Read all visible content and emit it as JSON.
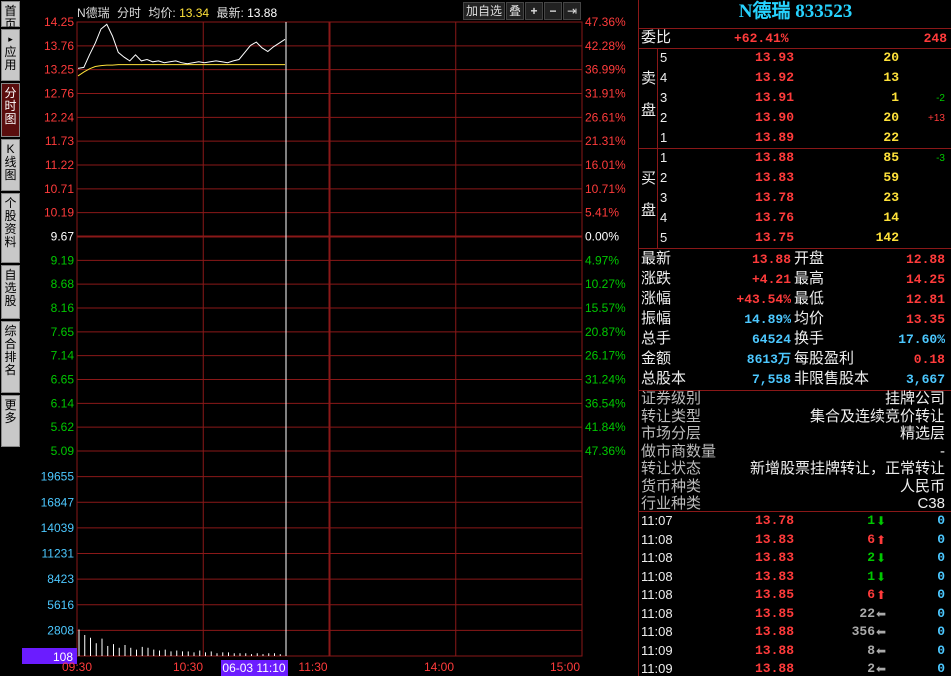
{
  "left_tabs": [
    {
      "label": "首页"
    },
    {
      "label": "应用",
      "prefix": "▸"
    },
    {
      "label": "分时图",
      "active": true
    },
    {
      "label": "K线图"
    },
    {
      "label": "个股资料"
    },
    {
      "label": "自选股"
    },
    {
      "label": "综合排名"
    },
    {
      "label": "更多"
    }
  ],
  "chart": {
    "header": {
      "name": "N德瑞",
      "mode": "分时",
      "avg_label": "均价:",
      "avg_value": "13.34",
      "last_label": "最新:",
      "last_value": "13.88"
    },
    "toolbar": {
      "add_fav": "加自选",
      "overlay": "叠"
    },
    "price_ticks": [
      "14.25",
      "13.76",
      "13.25",
      "12.76",
      "12.24",
      "11.73",
      "11.22",
      "10.71",
      "10.19",
      "9.67",
      "9.19",
      "8.68",
      "8.16",
      "7.65",
      "7.14",
      "6.65",
      "6.14",
      "5.62",
      "5.09"
    ],
    "pct_ticks": [
      "47.36%",
      "42.28%",
      "36.99%",
      "31.91%",
      "26.61%",
      "21.31%",
      "16.01%",
      "10.71%",
      "5.41%",
      "0.00%",
      "4.97%",
      "10.27%",
      "15.57%",
      "20.87%",
      "26.17%",
      "31.24%",
      "36.54%",
      "41.84%",
      "47.36%"
    ],
    "volume_ticks": [
      "19655",
      "16847",
      "14039",
      "11231",
      "8423",
      "5616",
      "2808"
    ],
    "cursor_volume": "108",
    "time_ticks": [
      "09:30",
      "10:30",
      "11:30",
      "14:00",
      "15:00"
    ],
    "cursor_time": "06-03 11:10",
    "price_line": [
      13.26,
      13.28,
      13.55,
      13.8,
      14.1,
      14.2,
      13.95,
      13.6,
      13.5,
      13.42,
      13.55,
      13.42,
      13.45,
      13.4,
      13.42,
      13.38,
      13.4,
      13.42,
      13.38,
      13.36,
      13.38,
      13.4,
      13.38,
      13.4,
      13.42,
      13.4,
      13.38,
      13.42,
      13.45,
      13.6,
      13.75,
      13.82,
      13.7,
      13.62,
      13.72,
      13.8,
      13.88
    ],
    "avg_line": [
      13.1,
      13.18,
      13.25,
      13.3,
      13.32,
      13.33,
      13.33,
      13.34,
      13.34,
      13.34,
      13.34,
      13.34,
      13.34,
      13.34,
      13.34,
      13.34,
      13.34,
      13.34,
      13.34,
      13.34,
      13.34,
      13.34,
      13.34,
      13.34,
      13.34,
      13.34,
      13.34,
      13.34,
      13.34,
      13.34,
      13.34,
      13.34,
      13.34,
      13.34,
      13.34,
      13.34,
      13.34
    ],
    "volumes": [
      2900,
      2300,
      2000,
      1400,
      1900,
      1100,
      1300,
      900,
      1200,
      900,
      700,
      1000,
      900,
      700,
      600,
      700,
      500,
      600,
      500,
      500,
      400,
      600,
      400,
      500,
      300,
      400,
      400,
      300,
      300,
      300,
      200,
      300,
      200,
      300,
      300,
      200,
      400
    ]
  },
  "quote": {
    "title": "N德瑞 833523",
    "ratio": {
      "label": "委比",
      "pct": "+62.41%",
      "diff": "248"
    },
    "sell_label": [
      "卖",
      "盘"
    ],
    "buy_label": [
      "买",
      "盘"
    ],
    "asks": [
      {
        "lv": "5",
        "p": "13.93",
        "v": "20",
        "c": ""
      },
      {
        "lv": "4",
        "p": "13.92",
        "v": "13",
        "c": ""
      },
      {
        "lv": "3",
        "p": "13.91",
        "v": "1",
        "c": "-2"
      },
      {
        "lv": "2",
        "p": "13.90",
        "v": "20",
        "c": "+13"
      },
      {
        "lv": "1",
        "p": "13.89",
        "v": "22",
        "c": ""
      }
    ],
    "bids": [
      {
        "lv": "1",
        "p": "13.88",
        "v": "85",
        "c": "-3"
      },
      {
        "lv": "2",
        "p": "13.83",
        "v": "59",
        "c": ""
      },
      {
        "lv": "3",
        "p": "13.78",
        "v": "23",
        "c": ""
      },
      {
        "lv": "4",
        "p": "13.76",
        "v": "14",
        "c": ""
      },
      {
        "lv": "5",
        "p": "13.75",
        "v": "142",
        "c": ""
      }
    ],
    "stats": [
      {
        "l1": "最新",
        "v1": "13.88",
        "c1": "red",
        "l2": "开盘",
        "v2": "12.88",
        "c2": "red"
      },
      {
        "l1": "涨跌",
        "v1": "+4.21",
        "c1": "red",
        "l2": "最高",
        "v2": "14.25",
        "c2": "red"
      },
      {
        "l1": "涨幅",
        "v1": "+43.54%",
        "c1": "red",
        "l2": "最低",
        "v2": "12.81",
        "c2": "red"
      },
      {
        "l1": "振幅",
        "v1": "14.89%",
        "c1": "cyan",
        "l2": "均价",
        "v2": "13.35",
        "c2": "red"
      },
      {
        "l1": "总手",
        "v1": "64524",
        "c1": "cyan",
        "l2": "换手",
        "v2": "17.60%",
        "c2": "cyan"
      },
      {
        "l1": "金额",
        "v1": "8613万",
        "c1": "cyan",
        "l2": "每股盈利",
        "v2": "0.18",
        "c2": "red"
      },
      {
        "l1": "总股本",
        "v1": "7,558",
        "c1": "cyan",
        "l2": "非限售股本",
        "v2": "3,667",
        "c2": "cyan"
      }
    ],
    "info": [
      {
        "k": "证券级别",
        "v": "挂牌公司"
      },
      {
        "k": "转让类型",
        "v": "集合及连续竞价转让"
      },
      {
        "k": "市场分层",
        "v": "精选层"
      },
      {
        "k": "做市商数量",
        "v": "-"
      },
      {
        "k": "转让状态",
        "v": "新增股票挂牌转让，正常转让"
      },
      {
        "k": "货币种类",
        "v": "人民币"
      },
      {
        "k": "行业种类",
        "v": "C38"
      }
    ],
    "trades": [
      {
        "t": "11:07",
        "p": "13.78",
        "v": "1",
        "dir": "down",
        "n": "0"
      },
      {
        "t": "11:08",
        "p": "13.83",
        "v": "6",
        "dir": "up",
        "n": "0"
      },
      {
        "t": "11:08",
        "p": "13.83",
        "v": "2",
        "dir": "down",
        "n": "0"
      },
      {
        "t": "11:08",
        "p": "13.83",
        "v": "1",
        "dir": "down",
        "n": "0"
      },
      {
        "t": "11:08",
        "p": "13.85",
        "v": "6",
        "dir": "up",
        "n": "0"
      },
      {
        "t": "11:08",
        "p": "13.85",
        "v": "22",
        "dir": "left",
        "n": "0"
      },
      {
        "t": "11:08",
        "p": "13.88",
        "v": "356",
        "dir": "left",
        "n": "0"
      },
      {
        "t": "11:09",
        "p": "13.88",
        "v": "8",
        "dir": "left",
        "n": "0"
      },
      {
        "t": "11:09",
        "p": "13.88",
        "v": "2",
        "dir": "left",
        "n": "0"
      }
    ]
  },
  "colors": {
    "grid": "#8a1818",
    "up": "#ff3b3b",
    "down": "#00c800",
    "flat": "#ffffff",
    "accent": "#4cc8ff",
    "title": "#27d3ff"
  }
}
